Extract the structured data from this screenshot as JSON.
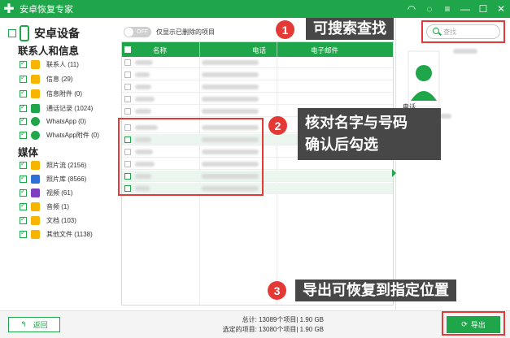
{
  "app": {
    "title": "安卓恢复专家"
  },
  "window_controls": [
    "wifi-icon",
    "chat-icon",
    "menu-icon",
    "minimize-icon",
    "maximize-icon",
    "close-icon"
  ],
  "sidebar": {
    "device_label": "安卓设备",
    "sections": [
      {
        "title": "联系人和信息",
        "items": [
          {
            "label": "联系人 (11)",
            "icon": "contacts-icon",
            "color": "#f7b500"
          },
          {
            "label": "信息 (29)",
            "icon": "messages-icon",
            "color": "#f7b500"
          },
          {
            "label": "信息附件 (0)",
            "icon": "attachment-icon",
            "color": "#f7b500"
          },
          {
            "label": "通话记录 (1024)",
            "icon": "call-log-icon",
            "color": "#1fa64a"
          },
          {
            "label": "WhatsApp (0)",
            "icon": "whatsapp-icon",
            "color": "#1fa64a"
          },
          {
            "label": "WhatsApp附件 (0)",
            "icon": "whatsapp-attachment-icon",
            "color": "#1fa64a"
          }
        ]
      },
      {
        "title": "媒体",
        "items": [
          {
            "label": "照片流 (2156)",
            "icon": "photo-stream-icon",
            "color": "#f7b500"
          },
          {
            "label": "照片库 (8566)",
            "icon": "photo-library-icon",
            "color": "#2f6fd6"
          },
          {
            "label": "视频 (61)",
            "icon": "video-icon",
            "color": "#7b3fbf"
          },
          {
            "label": "音频 (1)",
            "icon": "audio-icon",
            "color": "#f7b500"
          },
          {
            "label": "文档 (103)",
            "icon": "document-icon",
            "color": "#f7b500"
          },
          {
            "label": "其他文件 (1138)",
            "icon": "other-files-icon",
            "color": "#f7b500"
          }
        ]
      }
    ]
  },
  "toolbar": {
    "toggle_state": "OFF",
    "toggle_label": "仅显示已删除的项目"
  },
  "table": {
    "columns": [
      "名称",
      "电话",
      "电子邮件"
    ]
  },
  "detail": {
    "search_placeholder": "查找",
    "phone_label": "电话"
  },
  "footer": {
    "back_label": "返回",
    "total_text": "总计: 13089个项目| 1.90 GB",
    "selected_text": "选定的项目: 13080个项目| 1.90 GB",
    "export_label": "导出"
  },
  "annotations": [
    {
      "number": "1",
      "text": "可搜索查找"
    },
    {
      "number": "2",
      "text": "核对名字与号码",
      "text2": "确认后勾选"
    },
    {
      "number": "3",
      "text": "导出可恢复到指定位置"
    }
  ],
  "colors": {
    "brand_green": "#1fa64a",
    "annotation_red": "#e53935",
    "callout_bg": "#474747"
  }
}
